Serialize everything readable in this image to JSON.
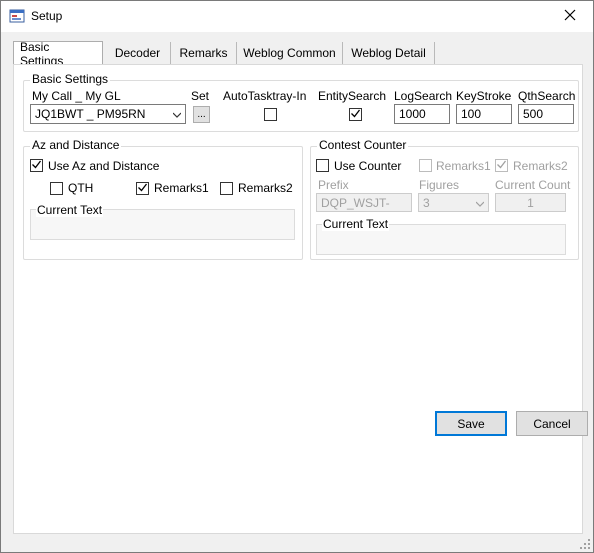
{
  "window": {
    "title": "Setup",
    "app_icon": "app-setup-icon",
    "close_icon": "close-icon"
  },
  "tabs": [
    {
      "label": "Basic Settings",
      "active": true
    },
    {
      "label": "Decoder"
    },
    {
      "label": "Remarks"
    },
    {
      "label": "Weblog Common"
    },
    {
      "label": "Weblog Detail"
    }
  ],
  "basic": {
    "group_label": "Basic Settings",
    "mycall_label": "My Call _ My GL",
    "mycall_value": "JQ1BWT _ PM95RN",
    "set_label": "Set",
    "set_button": "...",
    "autotasktray_label": "AutoTasktray-In",
    "autotasktray_checked": false,
    "entitysearch_label": "EntitySearch",
    "entitysearch_checked": true,
    "logsearch_label": "LogSearch",
    "logsearch_value": "1000",
    "keystroke_label": "KeyStroke",
    "keystroke_value": "100",
    "qthsearch_label": "QthSearch",
    "qthsearch_value": "500"
  },
  "az": {
    "group_label": "Az and Distance",
    "use_label": "Use Az and Distance",
    "use_checked": true,
    "qth_label": "QTH",
    "qth_checked": false,
    "remarks1_label": "Remarks1",
    "remarks1_checked": true,
    "remarks2_label": "Remarks2",
    "remarks2_checked": false,
    "current_text_label": "Current Text"
  },
  "contest": {
    "group_label": "Contest Counter",
    "use_label": "Use Counter",
    "use_checked": false,
    "remarks1_label": "Remarks1",
    "remarks1_checked": false,
    "remarks2_label": "Remarks2",
    "remarks2_checked": true,
    "prefix_label": "Prefix",
    "prefix_value": "DQP_WSJT-",
    "figures_label": "Figures",
    "figures_value": "3",
    "current_count_label": "Current Count",
    "current_count_value": "1",
    "current_text_label": "Current Text"
  },
  "buttons": {
    "save": "Save",
    "cancel": "Cancel"
  }
}
